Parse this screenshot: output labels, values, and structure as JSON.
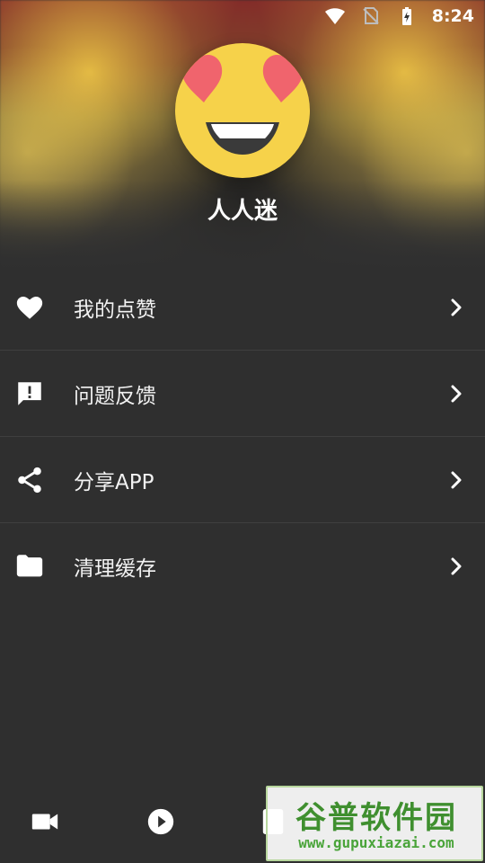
{
  "status_bar": {
    "time": "8:24",
    "icons": [
      "wifi-icon",
      "no-sim-icon",
      "battery-charging-icon"
    ]
  },
  "profile": {
    "avatar_icon": "heart-eyes-emoji",
    "name": "人人迷"
  },
  "menu": {
    "items": [
      {
        "icon": "heart-icon",
        "label": "我的点赞"
      },
      {
        "icon": "feedback-icon",
        "label": "问题反馈"
      },
      {
        "icon": "share-icon",
        "label": "分享APP"
      },
      {
        "icon": "folder-icon",
        "label": "清理缓存"
      }
    ]
  },
  "bottom_nav": {
    "items": [
      {
        "icon": "video-camera-icon"
      },
      {
        "icon": "play-icon"
      },
      {
        "icon": "me-icon"
      }
    ]
  },
  "watermark": {
    "title": "谷普软件园",
    "url": "www.gupuxiazai.com"
  },
  "colors": {
    "background": "#2f2f2f",
    "divider": "#3f3f3f",
    "text": "#f2f2f2",
    "avatar_yellow": "#f6d24a",
    "heart_red": "#f0646d"
  }
}
